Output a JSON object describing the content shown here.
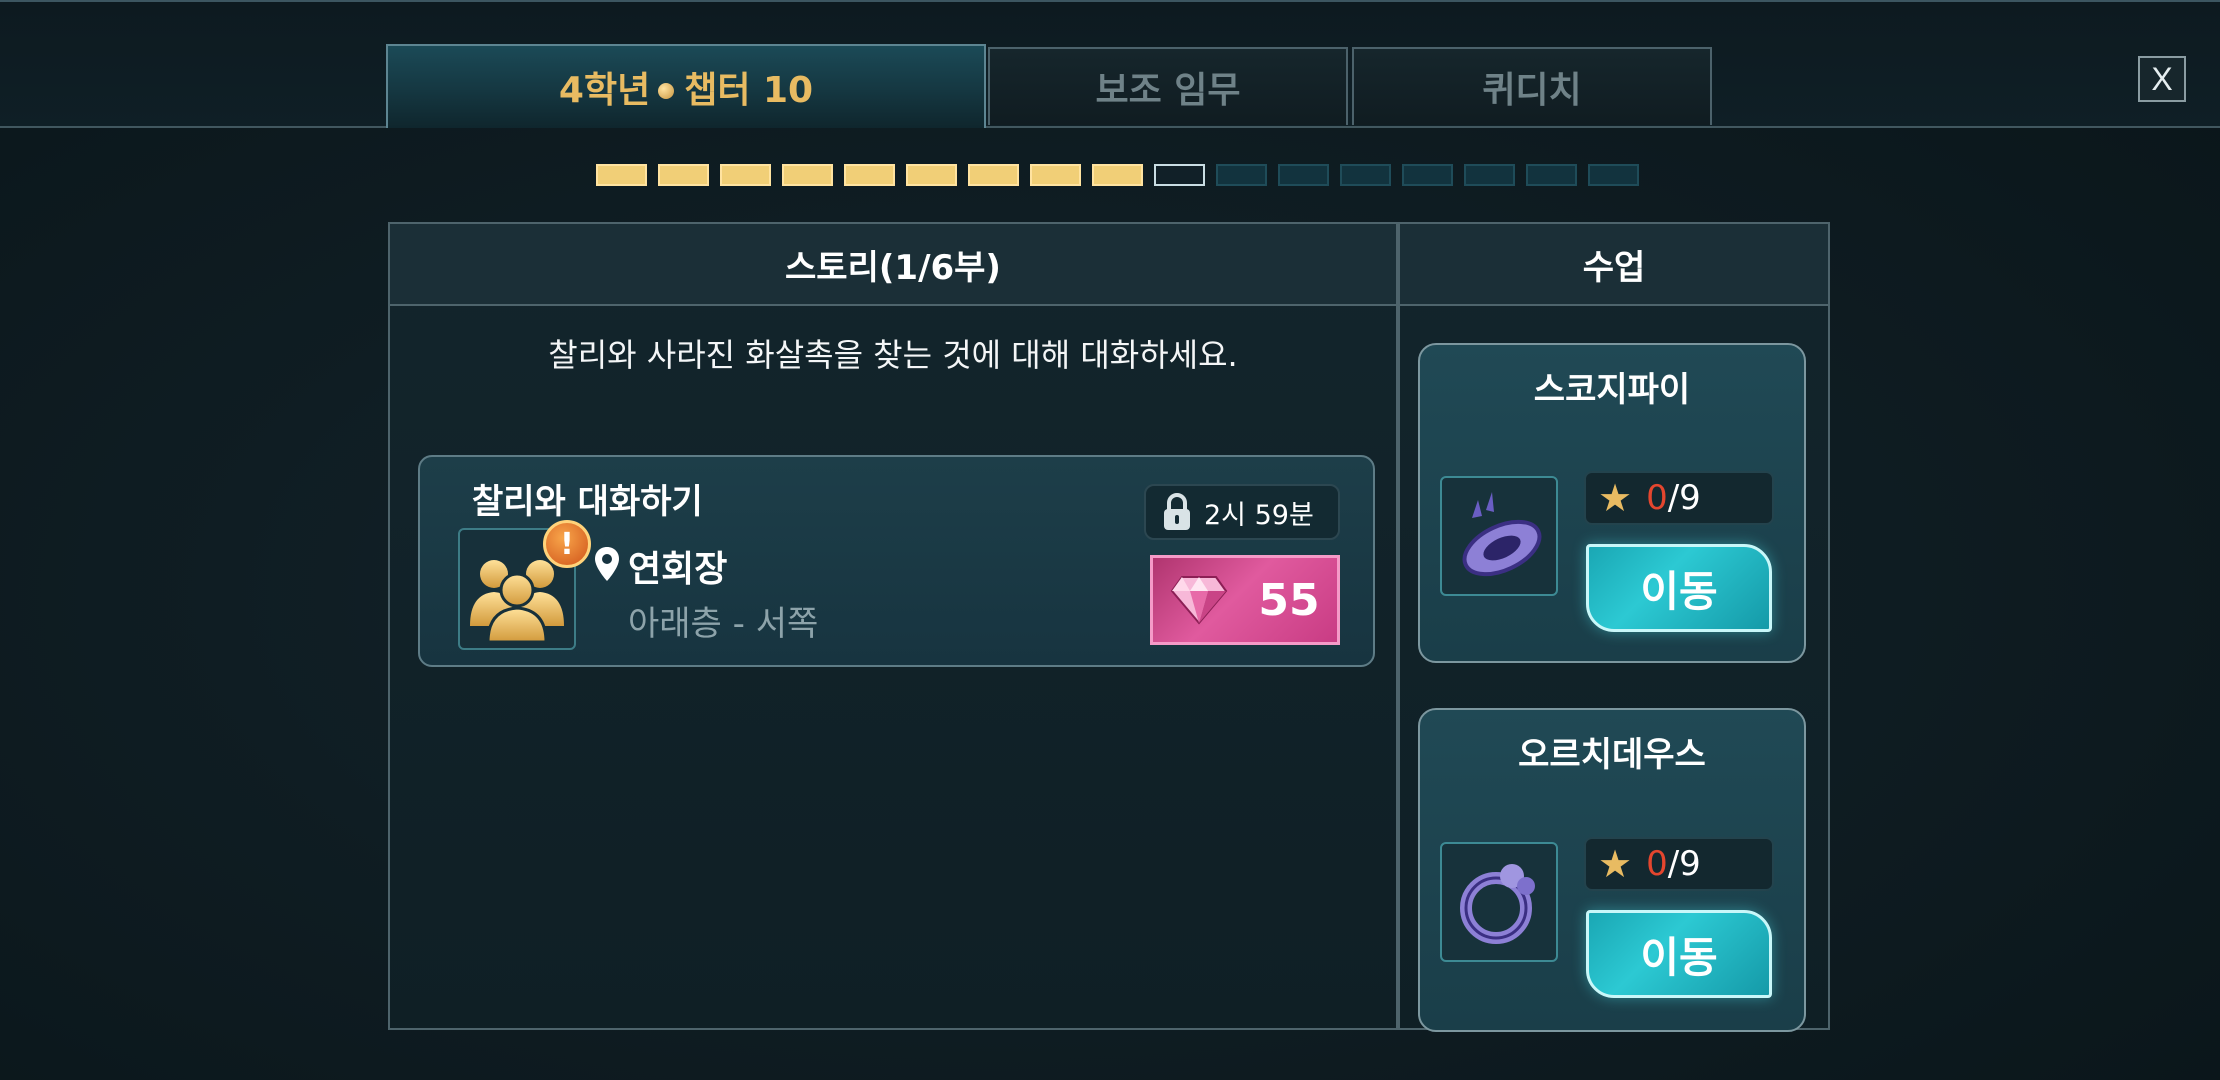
{
  "tabs": [
    {
      "label_year": "4학년",
      "label_chapter": "챕터 10",
      "active": true
    },
    {
      "label": "보조 임무",
      "active": false
    },
    {
      "label": "퀴디치",
      "active": false
    }
  ],
  "close_label": "X",
  "chapter_progress": {
    "completed": 9,
    "current": 10,
    "total": 17
  },
  "story": {
    "header": "스토리(1/6부)",
    "description": "찰리와 사라진 화살촉을 찾는 것에 대해 대화하세요.",
    "quest": {
      "title": "찰리와 대화하기",
      "alert": "!",
      "location": "연회장",
      "sublocation": "아래층 - 서쪽",
      "timer": "2시 59분",
      "reward_value": "55",
      "icon": "students-group-icon",
      "reward_icon": "gem-icon"
    }
  },
  "classes": {
    "header": "수업",
    "items": [
      {
        "name": "스코지파이",
        "stars_current": "0",
        "stars_total": "/9",
        "button": "이동",
        "icon": "scourgify-spell-icon"
      },
      {
        "name": "오르치데우스",
        "stars_current": "0",
        "stars_total": "/9",
        "button": "이동",
        "icon": "orchideous-spell-icon"
      }
    ]
  },
  "colors": {
    "gold": "#e8bb62",
    "reward_pink": "#e05a9e",
    "teal_button": "#2cc9d3",
    "star_current": "#e4462e"
  }
}
